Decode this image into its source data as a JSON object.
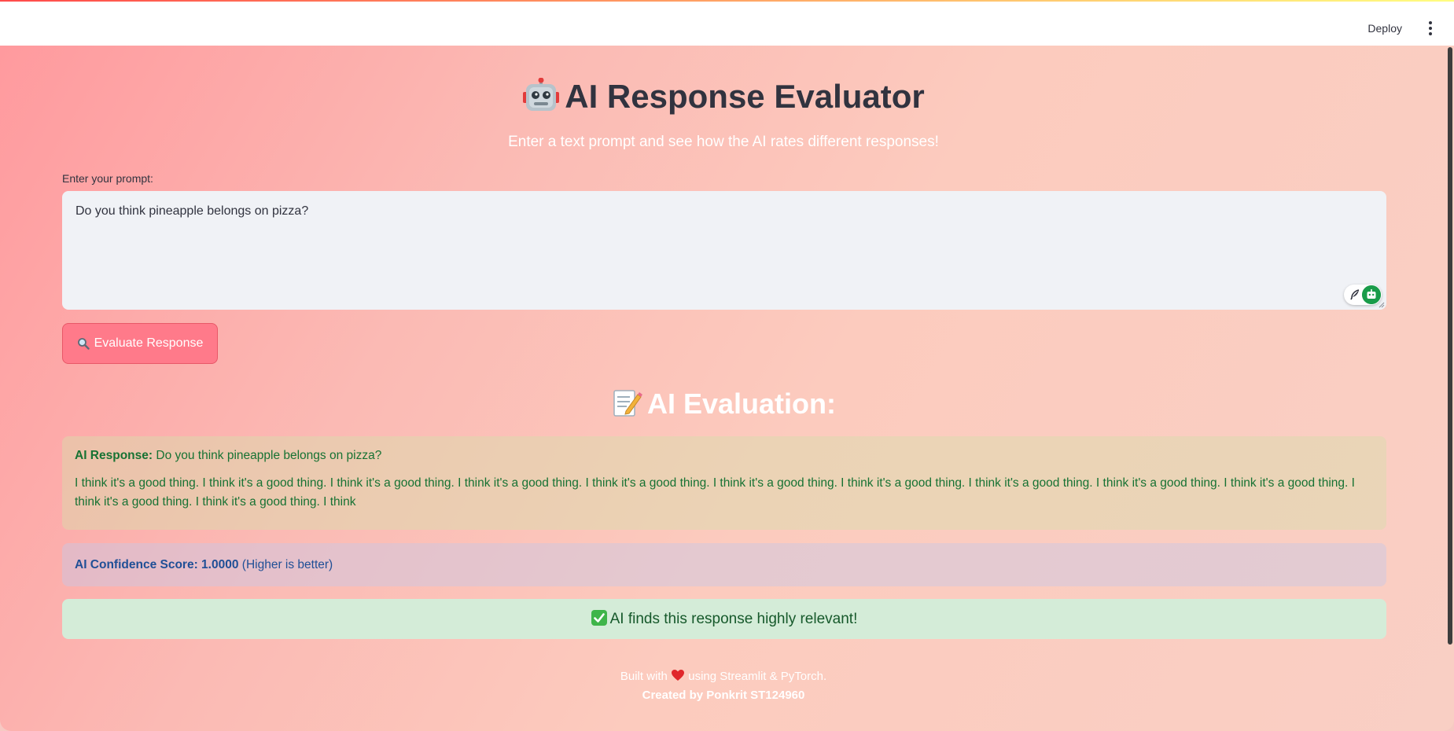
{
  "topbar": {
    "deploy_label": "Deploy",
    "menu_icon": "vertical-ellipsis-icon"
  },
  "header": {
    "title": "AI Response Evaluator",
    "title_icon": "robot-icon",
    "subtitle": "Enter a text prompt and see how the AI rates different responses!"
  },
  "prompt": {
    "label": "Enter your prompt:",
    "value": "Do you think pineapple belongs on pizza?"
  },
  "evaluate_button": {
    "label": "Evaluate Response",
    "icon": "magnifier-icon",
    "color": "#ff7a8a"
  },
  "evaluation": {
    "heading": "AI Evaluation:",
    "heading_icon": "memo-icon",
    "response_label": "AI Response:",
    "response_prompt": "Do you think pineapple belongs on pizza?",
    "response_body": "I think it's a good thing. I think it's a good thing. I think it's a good thing. I think it's a good thing. I think it's a good thing. I think it's a good thing. I think it's a good thing. I think it's a good thing. I think it's a good thing. I think it's a good thing. I think it's a good thing. I think it's a good thing. I think",
    "score_label": "AI Confidence Score: 1.0000",
    "score_note": "(Higher is better)",
    "verdict": "AI finds this response highly relevant!",
    "verdict_icon": "check-mark-icon"
  },
  "footer": {
    "line1_prefix": "Built with",
    "line1_suffix": "using Streamlit & PyTorch.",
    "heart_icon": "heart-icon",
    "line2": "Created by Ponkrit ST124960"
  },
  "colors": {
    "success_bg": "#d4ecd8",
    "success_text": "#16592b",
    "info_text": "#1f4f96",
    "response_text": "#177233"
  }
}
